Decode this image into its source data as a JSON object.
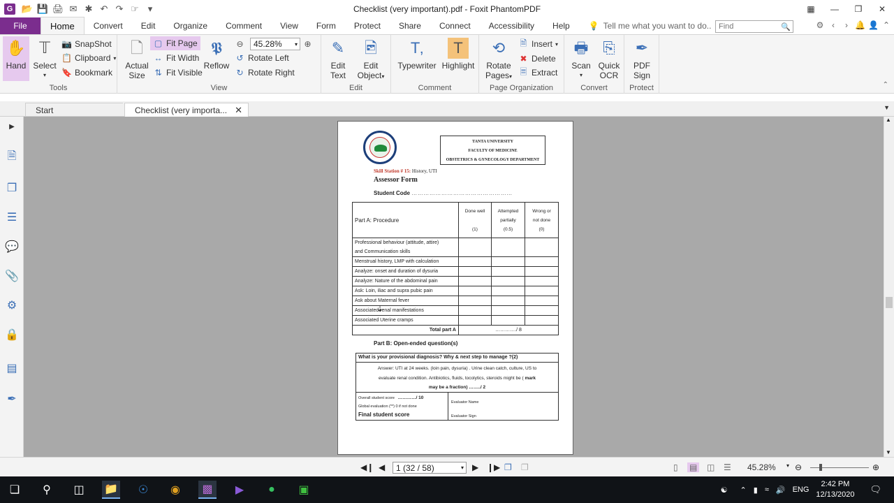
{
  "window": {
    "title": "Checklist (very important).pdf - Foxit PhantomPDF"
  },
  "menu": {
    "file": "File",
    "tabs": [
      "Home",
      "Convert",
      "Edit",
      "Organize",
      "Comment",
      "View",
      "Form",
      "Protect",
      "Share",
      "Connect",
      "Accessibility",
      "Help"
    ],
    "tell_me": "Tell me what you want to do..",
    "find_placeholder": "Find"
  },
  "ribbon": {
    "tools": {
      "hand": "Hand",
      "select": "Select",
      "snapshot": "SnapShot",
      "clipboard": "Clipboard",
      "bookmark": "Bookmark",
      "label": "Tools"
    },
    "view": {
      "actual_size_1": "Actual",
      "actual_size_2": "Size",
      "fit_page": "Fit Page",
      "fit_width": "Fit Width",
      "fit_visible": "Fit Visible",
      "reflow": "Reflow",
      "zoom": "45.28%",
      "rotate_left": "Rotate Left",
      "rotate_right": "Rotate Right",
      "label": "View"
    },
    "edit": {
      "edit_text_1": "Edit",
      "edit_text_2": "Text",
      "edit_object_1": "Edit",
      "edit_object_2": "Object",
      "label": "Edit"
    },
    "comment": {
      "typewriter": "Typewriter",
      "highlight": "Highlight",
      "label": "Comment"
    },
    "page_org": {
      "rotate_pages_1": "Rotate",
      "rotate_pages_2": "Pages",
      "insert": "Insert",
      "delete": "Delete",
      "extract": "Extract",
      "label": "Page Organization"
    },
    "convert": {
      "scan": "Scan",
      "quick_ocr_1": "Quick",
      "quick_ocr_2": "OCR",
      "label": "Convert"
    },
    "protect": {
      "pdf_sign_1": "PDF",
      "pdf_sign_2": "Sign",
      "label": "Protect"
    }
  },
  "doc_tabs": {
    "start": "Start",
    "active": "Checklist (very importa..."
  },
  "page": {
    "uni_line1": "TANTA UNIVERSITY",
    "uni_line2": "FACULTY OF MEDICINE",
    "uni_line3": "OBSTETRICS & GYNECOLOGY DEPARTMENT",
    "skill_station": "Skill Station # 15:",
    "skill_topic": " History, UTI",
    "assessor_form": "Assessor Form",
    "student_code": "Student Code",
    "student_code_dots": "……………………………………………",
    "table_header": {
      "part": "Part A: Procedure",
      "done_1": "Done well",
      "done_2": "(1)",
      "attempted_1": "Attempted",
      "attempted_2": "partially",
      "attempted_3": "(0.5)",
      "wrong_1": "Wrong or",
      "wrong_2": "not done",
      "wrong_3": "(0)"
    },
    "items": [
      "Professional behaviour (attitude, attire)",
      "and Communication skills",
      "Menstrual history, LMP with calculation",
      "Analyze: onset and duration of dysuria",
      "Analyze: Nature of the abdominal pain",
      "Ask: Loin, iliac and supra pubic pain",
      "Ask about Maternal fever",
      "Associated renal manifestations",
      "Associated Uterine cramps"
    ],
    "total_label": "Total part A",
    "total_value": "…………./ 8",
    "part_b": "Part B: Open-ended question(s)",
    "question": "What is your provisional diagnosis? Why & next step to manage ?(2)",
    "answer_1": "Answer:  UTI at 24 weeks. (loin pain, dysuria) . Urine clean catch, culture, US to",
    "answer_2": "evaluate renal condition. Antibiotics, fluids, tocolytics, steroids might be (",
    "answer_mark": " mark",
    "answer_3": "may be a fraction)  ……../ 2",
    "overall": "Overall student score",
    "overall_val": "…………/ 10",
    "global_eval": "Global evaluation (**)  0 if not done",
    "final_score": "Final student score",
    "evaluator_name": "Evaluator Name",
    "evaluator_sign": "Evaluator Sign"
  },
  "status": {
    "page_indicator": "1 (32 / 58)",
    "zoom": "45.28%"
  },
  "taskbar": {
    "time": "2:42 PM",
    "date": "12/13/2020",
    "lang": "ENG"
  }
}
